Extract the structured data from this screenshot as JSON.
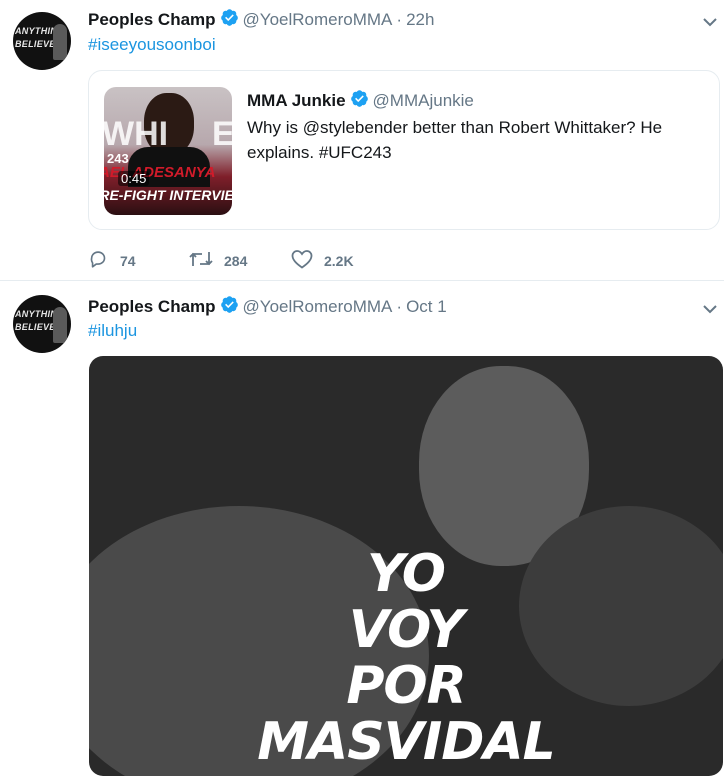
{
  "tweets": [
    {
      "avatar_text": [
        "ANYTHING",
        "BELIEVE"
      ],
      "name": "Peoples Champ",
      "handle": "@YoelRomeroMMA",
      "dot": "·",
      "time": "22h",
      "hashtag": "#iseeyousoonboi",
      "quote": {
        "name": "MMA Junkie",
        "handle": "@MMAjunkie",
        "text": "Why is @stylebender better than Robert Whittaker? He explains. #UFC243",
        "thumb_big": "WHI",
        "thumb_e": "E",
        "thumb_243": "243",
        "thumb_name": "ISRAEL ADESANYA",
        "thumb_duration": "0:45",
        "thumb_caption": "PRE-FIGHT INTERVIEW"
      },
      "actions": {
        "replies": "74",
        "retweets": "284",
        "likes": "2.2K"
      }
    },
    {
      "avatar_text": [
        "ANYTHING",
        "BELIEVE"
      ],
      "name": "Peoples Champ",
      "handle": "@YoelRomeroMMA",
      "dot": "·",
      "time": "Oct 1",
      "hashtag": "#iluhju",
      "media_lines": [
        "YO",
        "VOY",
        "POR",
        "MASVIDAL"
      ]
    }
  ],
  "colors": {
    "link": "#1b95e0",
    "verified": "#1da1f2",
    "muted": "#657786",
    "border": "#e6ecf0"
  }
}
